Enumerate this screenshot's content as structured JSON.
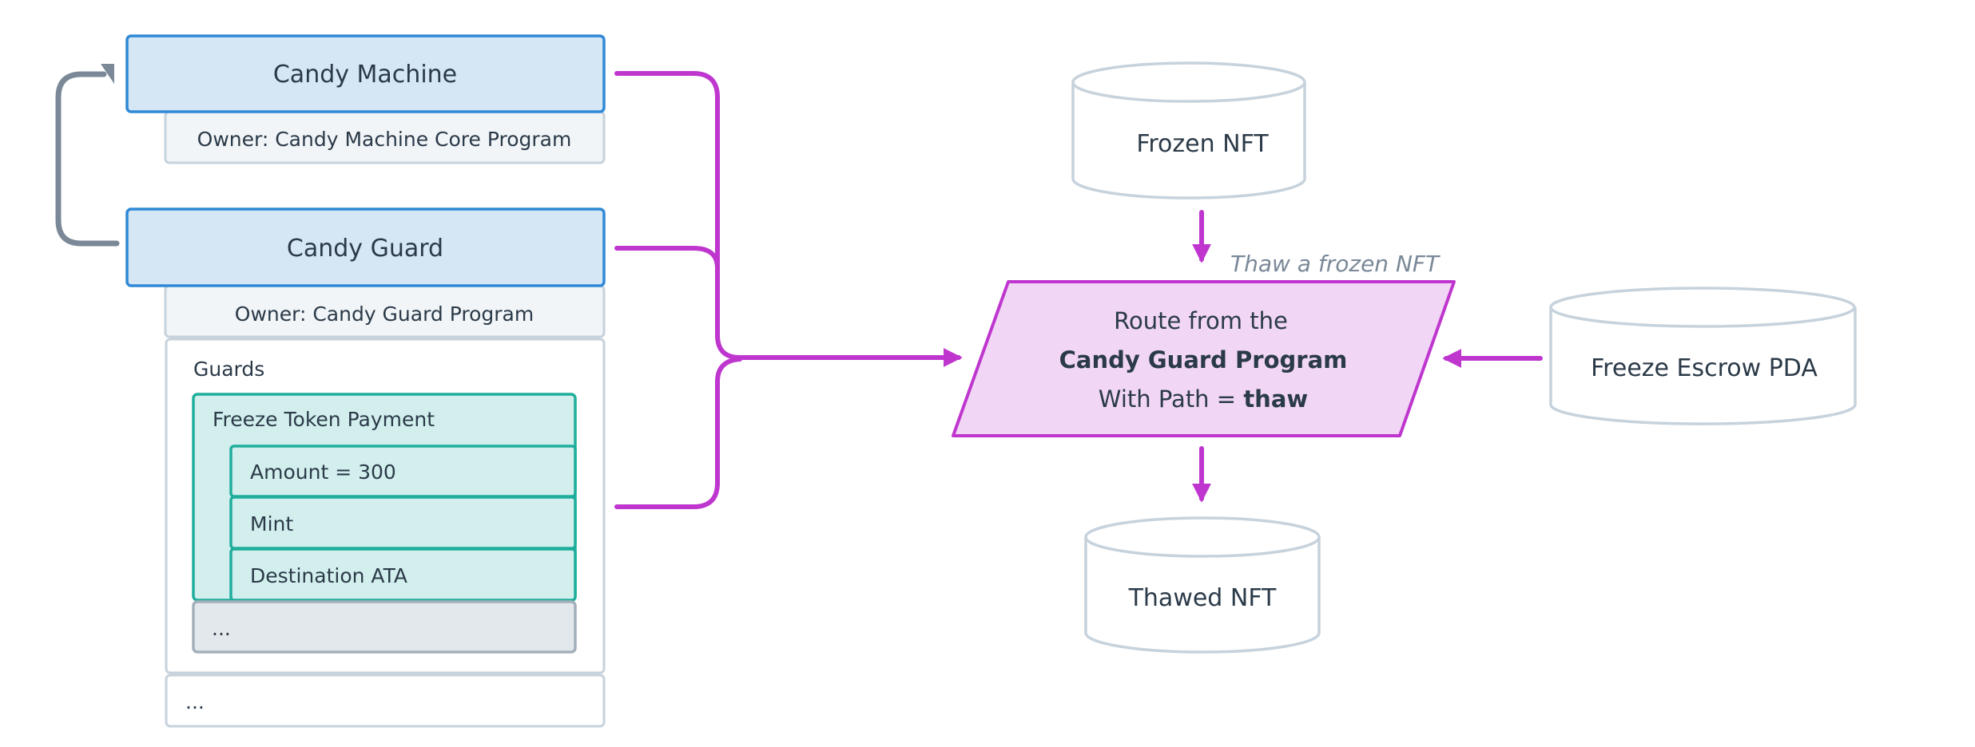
{
  "colors": {
    "account_fill": "#d5e6f5",
    "account_stroke": "#2f89d6",
    "owner_fill": "#f1f5f8",
    "owner_stroke": "#c6d2dc",
    "guard_fill": "#d2efee",
    "guard_stroke": "#1fae9c",
    "more_fill": "#e3e8ec",
    "more_stroke": "#a3afba",
    "route_fill": "#f1d6f5",
    "route_stroke": "#bf36cf",
    "connector": "#bf36cf",
    "loop": "#7b8897",
    "text": "#2b3a48",
    "label_text": "#7a8898"
  },
  "accounts": {
    "candy_machine": {
      "title": "Candy Machine",
      "owner": "Owner: Candy Machine Core Program"
    },
    "candy_guard": {
      "title": "Candy Guard",
      "owner": "Owner: Candy Guard Program",
      "guards_heading": "Guards",
      "guard": {
        "name": "Freeze Token Payment",
        "fields": [
          "Amount = 300",
          "Mint",
          "Destination ATA"
        ]
      },
      "more_guards": "...",
      "more_fields": "..."
    }
  },
  "route": {
    "line1": "Route from the",
    "line2": "Candy Guard Program",
    "line3_prefix": "With Path = ",
    "line3_value": "thaw",
    "edge_label": "Thaw a frozen NFT"
  },
  "stores": {
    "frozen_nft": "Frozen NFT",
    "thawed_nft": "Thawed NFT",
    "freeze_escrow": "Freeze Escrow PDA"
  }
}
